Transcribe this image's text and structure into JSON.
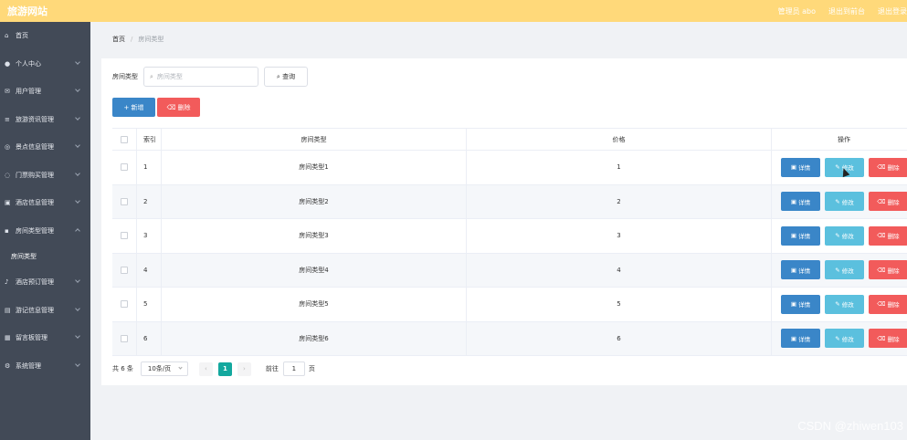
{
  "header": {
    "logo": "旅游网站",
    "admin_text": "管理员 abo",
    "backend_link": "退出到前台",
    "logout_link": "退出登录"
  },
  "sidebar": {
    "items": [
      {
        "label": "首页",
        "icon": "home-icon"
      },
      {
        "label": "个人中心",
        "icon": "user-icon"
      },
      {
        "label": "用户管理",
        "icon": "mail-icon"
      },
      {
        "label": "旅游资讯管理",
        "icon": "filter-icon"
      },
      {
        "label": "景点信息管理",
        "icon": "target-icon"
      },
      {
        "label": "门票购买管理",
        "icon": "compass-icon"
      },
      {
        "label": "酒店信息管理",
        "icon": "picture-icon"
      },
      {
        "label": "房间类型管理",
        "icon": "chat-icon"
      },
      {
        "label": "房间类型",
        "icon": ""
      },
      {
        "label": "酒店预订管理",
        "icon": "mic-icon"
      },
      {
        "label": "游记信息管理",
        "icon": "document-icon"
      },
      {
        "label": "留言板管理",
        "icon": "grid-icon"
      },
      {
        "label": "系统管理",
        "icon": "settings-icon"
      }
    ]
  },
  "breadcrumb": {
    "home": "首页",
    "separator": "/",
    "current": "房间类型"
  },
  "search": {
    "label": "房间类型",
    "placeholder": "房间类型",
    "button": "查询"
  },
  "actions": {
    "add": "新增",
    "delete": "删除"
  },
  "table": {
    "headers": {
      "index": "索引",
      "type": "房间类型",
      "price": "价格",
      "ops": "操作"
    },
    "rows": [
      {
        "index": "1",
        "type": "房间类型1",
        "price": "1"
      },
      {
        "index": "2",
        "type": "房间类型2",
        "price": "2"
      },
      {
        "index": "3",
        "type": "房间类型3",
        "price": "3"
      },
      {
        "index": "4",
        "type": "房间类型4",
        "price": "4"
      },
      {
        "index": "5",
        "type": "房间类型5",
        "price": "5"
      },
      {
        "index": "6",
        "type": "房间类型6",
        "price": "6"
      }
    ],
    "op_labels": {
      "detail": "详情",
      "edit": "修改",
      "remove": "删除"
    }
  },
  "pagination": {
    "total": "共 6 条",
    "page_size": "10条/页",
    "current": "1",
    "goto_label": "前往",
    "goto_value": "1",
    "goto_suffix": "页"
  },
  "watermark": "CSDN @zhiwen103",
  "colors": {
    "topbar": "#ffd97a",
    "sidebar": "#424a57",
    "primary": "#3a86c8",
    "info": "#5bc0de",
    "danger": "#f25b5b",
    "pager_active": "#13a89e"
  }
}
